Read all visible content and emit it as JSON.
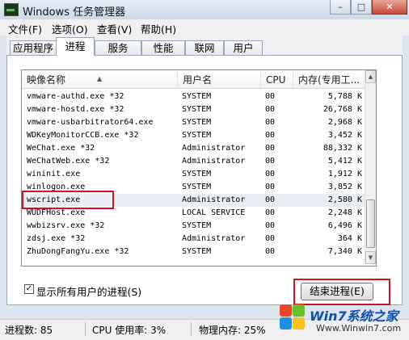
{
  "window": {
    "title": "Windows 任务管理器",
    "controls": {
      "minimize": "–",
      "maximize": "□",
      "close": "✕"
    }
  },
  "menu": [
    "文件(F)",
    "选项(O)",
    "查看(V)",
    "帮助(H)"
  ],
  "tabs": [
    "应用程序",
    "进程",
    "服务",
    "性能",
    "联网",
    "用户"
  ],
  "active_tab": "进程",
  "columns": {
    "name": "映像名称",
    "user": "用户名",
    "cpu": "CPU",
    "mem": "内存(专用工..."
  },
  "processes": [
    {
      "name": "vmware-authd.exe *32",
      "user": "SYSTEM",
      "cpu": "00",
      "mem": "5,788 K"
    },
    {
      "name": "vmware-hostd.exe *32",
      "user": "SYSTEM",
      "cpu": "00",
      "mem": "26,768 K"
    },
    {
      "name": "vmware-usbarbitrator64.exe",
      "user": "SYSTEM",
      "cpu": "00",
      "mem": "2,968 K"
    },
    {
      "name": "WDKeyMonitorCCB.exe *32",
      "user": "SYSTEM",
      "cpu": "00",
      "mem": "3,452 K"
    },
    {
      "name": "WeChat.exe *32",
      "user": "Administrator",
      "cpu": "00",
      "mem": "88,332 K"
    },
    {
      "name": "WeChatWeb.exe *32",
      "user": "Administrator",
      "cpu": "00",
      "mem": "5,412 K"
    },
    {
      "name": "wininit.exe",
      "user": "SYSTEM",
      "cpu": "00",
      "mem": "1,912 K"
    },
    {
      "name": "winlogon.exe",
      "user": "SYSTEM",
      "cpu": "00",
      "mem": "3,852 K"
    },
    {
      "name": "wscript.exe",
      "user": "Administrator",
      "cpu": "00",
      "mem": "2,580 K"
    },
    {
      "name": "WUDFHost.exe",
      "user": "LOCAL SERVICE",
      "cpu": "00",
      "mem": "2,248 K"
    },
    {
      "name": "wwbizsrv.exe *32",
      "user": "SYSTEM",
      "cpu": "00",
      "mem": "6,496 K"
    },
    {
      "name": "zdsj.exe *32",
      "user": "Administrator",
      "cpu": "00",
      "mem": "364 K"
    },
    {
      "name": "ZhuDongFangYu.exe *32",
      "user": "SYSTEM",
      "cpu": "00",
      "mem": "7,340 K"
    }
  ],
  "selected_process": "wscript.exe",
  "show_all_users": {
    "label": "显示所有用户的进程(S)",
    "checked": true,
    "mark": "✓"
  },
  "end_process_button": "结束进程(E)",
  "status": {
    "processes": "进程数: 85",
    "cpu": "CPU 使用率: 3%",
    "memory": "物理内存: 25%"
  },
  "watermark": {
    "brand": "Win7系统之家",
    "url": "Www.Winwin7.com"
  },
  "colors": {
    "annotation": "#d4101a",
    "title_gradient": "#cdd9e8",
    "brand": "#0f4fa8"
  }
}
